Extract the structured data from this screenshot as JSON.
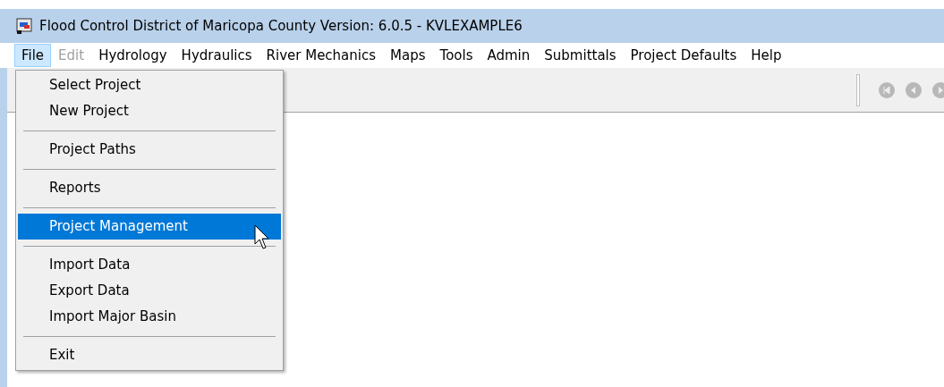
{
  "window": {
    "title": "Flood Control District of Maricopa County Version: 6.0.5 - KVLEXAMPLE6"
  },
  "menu_bar": [
    {
      "label": "File",
      "selected": true,
      "disabled": false
    },
    {
      "label": "Edit",
      "selected": false,
      "disabled": true
    },
    {
      "label": "Hydrology",
      "selected": false,
      "disabled": false
    },
    {
      "label": "Hydraulics",
      "selected": false,
      "disabled": false
    },
    {
      "label": "River Mechanics",
      "selected": false,
      "disabled": false
    },
    {
      "label": "Maps",
      "selected": false,
      "disabled": false
    },
    {
      "label": "Tools",
      "selected": false,
      "disabled": false
    },
    {
      "label": "Admin",
      "selected": false,
      "disabled": false
    },
    {
      "label": "Submittals",
      "selected": false,
      "disabled": false
    },
    {
      "label": "Project Defaults",
      "selected": false,
      "disabled": false
    },
    {
      "label": "Help",
      "selected": false,
      "disabled": false
    }
  ],
  "file_menu": [
    {
      "kind": "item",
      "label": "Select Project",
      "selected": false
    },
    {
      "kind": "item",
      "label": "New Project",
      "selected": false
    },
    {
      "kind": "separator"
    },
    {
      "kind": "item",
      "label": "Project Paths",
      "selected": false
    },
    {
      "kind": "separator"
    },
    {
      "kind": "item",
      "label": "Reports",
      "selected": false
    },
    {
      "kind": "separator"
    },
    {
      "kind": "item",
      "label": "Project Management",
      "selected": true
    },
    {
      "kind": "separator"
    },
    {
      "kind": "item",
      "label": "Import Data",
      "selected": false
    },
    {
      "kind": "item",
      "label": "Export Data",
      "selected": false
    },
    {
      "kind": "item",
      "label": "Import Major Basin",
      "selected": false
    },
    {
      "kind": "separator"
    },
    {
      "kind": "item",
      "label": "Exit",
      "selected": false
    }
  ]
}
